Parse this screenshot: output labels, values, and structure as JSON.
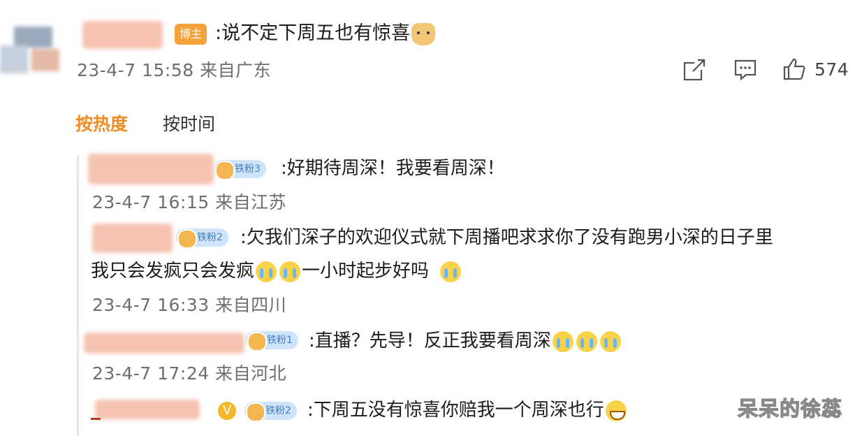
{
  "post": {
    "badge": "博主",
    "text": ":说不定下周五也有惊喜",
    "timestamp": "23-4-7 15:58 来自广东",
    "like_count": "574"
  },
  "sort_tabs": [
    {
      "label": "按热度",
      "active": true
    },
    {
      "label": "按时间",
      "active": false
    }
  ],
  "replies": [
    {
      "fan_badge": "铁粉3",
      "text": ":好期待周深！我要看周深！",
      "timestamp": "23-4-7 16:15 来自江苏"
    },
    {
      "fan_badge": "铁粉2",
      "text_line1": ":欠我们深子的欢迎仪式就下周播吧求求你了没有跑男小深的日子里",
      "text_line2a": "我只会发疯只会发疯",
      "text_line2b": "一小时起步好吗",
      "timestamp": "23-4-7 16:33 来自四川"
    },
    {
      "fan_badge": "铁粉1",
      "text": ":直播？先导！反正我要看周深",
      "timestamp": "23-4-7 17:24 来自河北"
    },
    {
      "fan_badge": "铁粉2",
      "verified_mark": "V",
      "text": ":下周五没有惊喜你赔我一个周深也行"
    }
  ],
  "watermark": "呆呆的徐蕊",
  "colors": {
    "accent_orange": "#f08c23",
    "fan_badge_bg": "#cfe4fb",
    "fan_badge_text": "#3b7ec6",
    "meta_gray": "#6e6e6e"
  },
  "icons": [
    "share-icon",
    "comment-icon",
    "like-icon",
    "doge-emoji",
    "cry-emoji",
    "grin-emoji"
  ]
}
